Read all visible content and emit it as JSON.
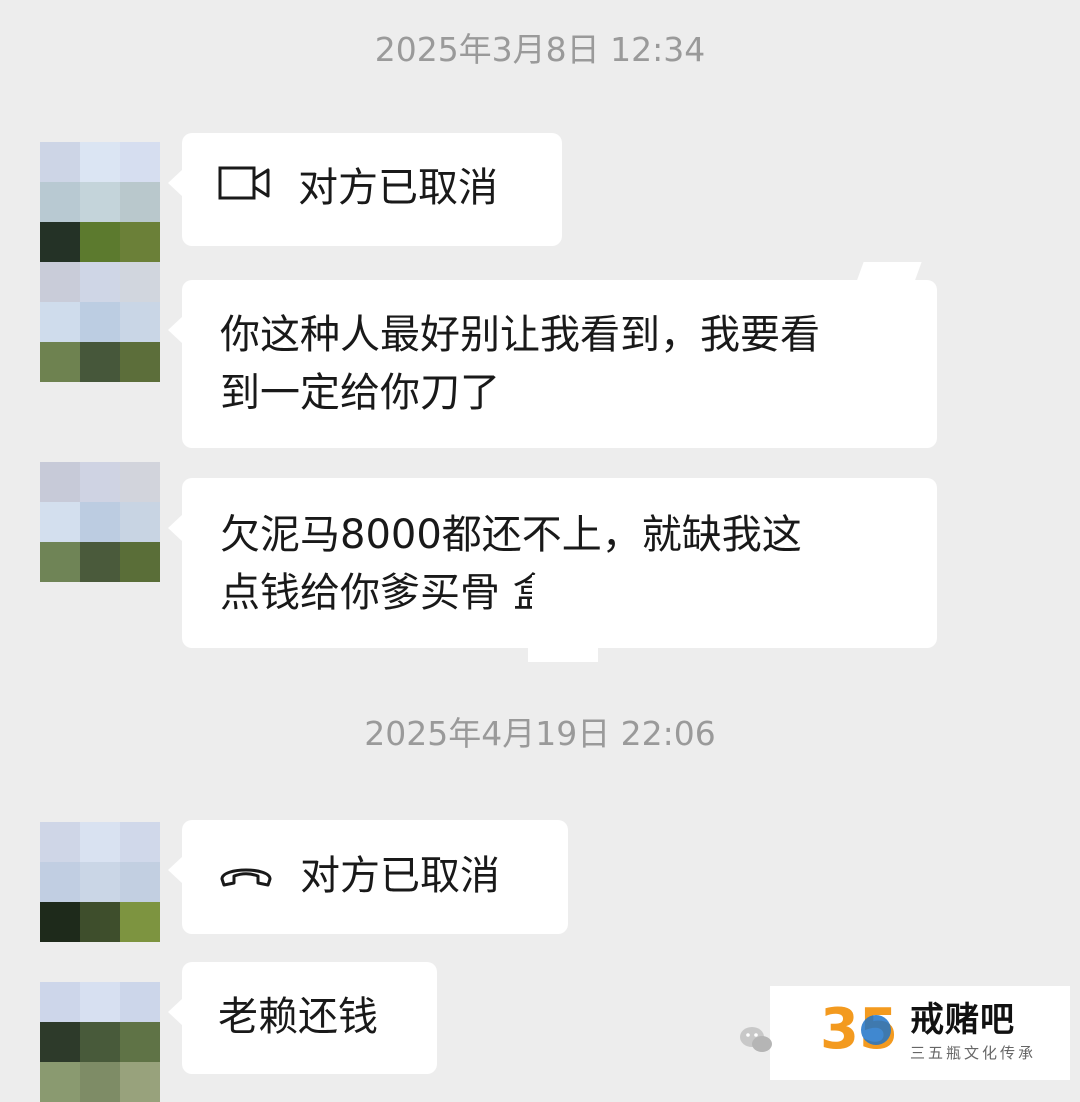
{
  "timestamps": [
    "2025年3月8日 12:34",
    "2025年4月19日 22:06"
  ],
  "messages": [
    {
      "type": "video-call",
      "icon": "video-camera-icon",
      "text": "对方已取消"
    },
    {
      "type": "text",
      "lines": [
        "你这种人最好别让我看到，我要看",
        "到一定给你刀了"
      ]
    },
    {
      "type": "text",
      "lines": [
        "欠泥马8000都还不上，就缺我这",
        "点钱给你爹买骨    盒?"
      ]
    },
    {
      "type": "voice-call",
      "icon": "phone-handset-icon",
      "text": "对方已取消"
    },
    {
      "type": "text",
      "lines": [
        "老赖还钱"
      ]
    }
  ],
  "watermark": {
    "logo_text": "35",
    "title": "戒赌吧",
    "subtitle": "三五瓶文化传承"
  },
  "colors": {
    "background": "#ededed",
    "bubble": "#ffffff",
    "text": "#191919",
    "timestamp": "#9a9a9a",
    "logo_orange": "#f39a1f",
    "logo_blue": "#1e73c8"
  },
  "avatars": [
    [
      [
        "#cdd5e6",
        "#dbe5f3",
        "#d6def0"
      ],
      [
        "#b8c9d2",
        "#c4d4da",
        "#b9c8cc"
      ],
      [
        "#243226",
        "#5c7a2e",
        "#6b8038"
      ]
    ],
    [
      [
        "#c9ccd9",
        "#cfd6e6",
        "#d1d6de"
      ],
      [
        "#cfdcec",
        "#bccde2",
        "#c9d6e6"
      ],
      [
        "#6e8250",
        "#46573a",
        "#5c6e3a"
      ]
    ],
    [
      [
        "#c7cad8",
        "#cfd3e3",
        "#d2d4dc"
      ],
      [
        "#d3dfee",
        "#bccce1",
        "#c8d4e3"
      ],
      [
        "#6f8456",
        "#4a5a3b",
        "#5a6e38"
      ]
    ],
    [
      [
        "#cfd6e7",
        "#d9e2f1",
        "#d0d8ea"
      ],
      [
        "#c1cee2",
        "#cad6e6",
        "#c2cfe1"
      ],
      [
        "#1e2a1b",
        "#3e4e2c",
        "#7d9440"
      ]
    ],
    [
      [
        "#cdd6ea",
        "#d7e0f1",
        "#ccd6ea"
      ],
      [
        "#2d3a2a",
        "#485a3a",
        "#5f7346"
      ],
      [
        "#8a9a70",
        "#7e8c66",
        "#98a27c"
      ]
    ]
  ]
}
